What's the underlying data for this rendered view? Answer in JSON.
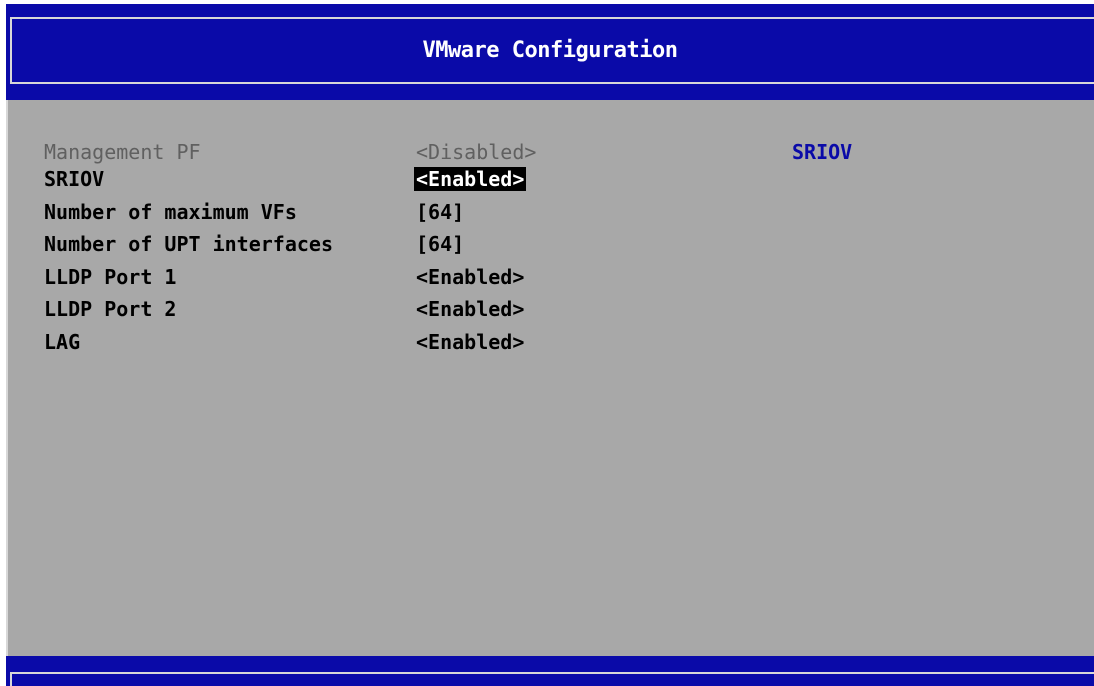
{
  "window": {
    "title": "VMware Configuration"
  },
  "settings": [
    {
      "label": "Management PF",
      "value": "<Disabled>",
      "state": "dimmed"
    },
    {
      "label": "SRIOV",
      "value": "<Enabled>",
      "state": "selected"
    },
    {
      "label": "Number of maximum VFs",
      "value": "[64]",
      "state": "normal"
    },
    {
      "label": "Number of UPT interfaces",
      "value": "[64]",
      "state": "normal"
    },
    {
      "label": "LLDP Port 1",
      "value": "<Enabled>",
      "state": "normal"
    },
    {
      "label": "LLDP Port 2",
      "value": "<Enabled>",
      "state": "normal"
    },
    {
      "label": "LAG",
      "value": "<Enabled>",
      "state": "normal"
    }
  ],
  "help_panel": {
    "text": "SRIOV"
  },
  "colors": {
    "title_bar": "#0a0aa8",
    "content_bg": "#a8a8a8",
    "help_text": "#0a0aa8",
    "selected_bg": "#000000",
    "selected_fg": "#ffffff",
    "dimmed_text": "#606060"
  }
}
